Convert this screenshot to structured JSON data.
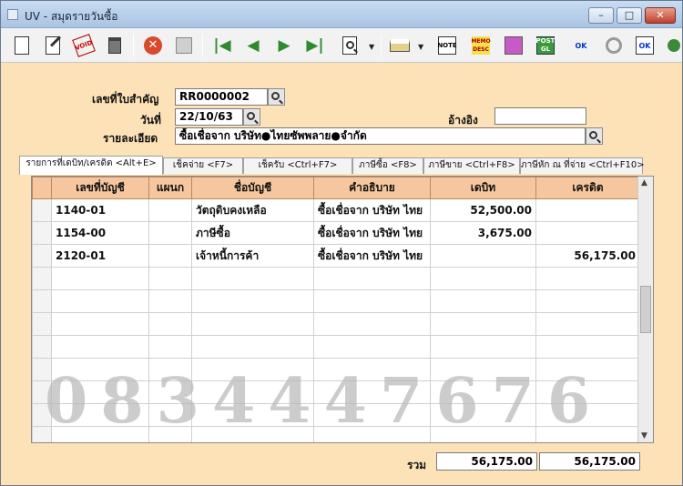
{
  "window": {
    "title": "UV - สมุดรายวันซื้อ"
  },
  "toolbar": {
    "icons": [
      "new-icon",
      "edit-icon",
      "void-icon",
      "delete-icon",
      "cancel-icon",
      "save-icon",
      "first-icon",
      "prev-icon",
      "next-icon",
      "last-icon",
      "search-icon",
      "print-icon",
      "note-icon",
      "memo-desc-icon",
      "grid-icon",
      "post-gl-icon",
      "approve-ok-icon",
      "tools-icon",
      "confirm-ok-icon"
    ],
    "labels": {
      "note": "NOTE",
      "desc": "MEMO DESC",
      "post": "POST GL",
      "ok": "OK"
    }
  },
  "form": {
    "doc_no_label": "เลขที่ใบสำคัญ",
    "doc_no": "RR0000002",
    "date_label": "วันที่",
    "date": "22/10/63",
    "ref_label": "อ้างอิง",
    "ref": "",
    "desc_label": "รายละเอียด",
    "desc": "ซื้อเชื่อจาก  บริษัท●ไทยซัพพลาย●จำกัด"
  },
  "tabs": [
    "รายการที่เดบิท/เครดิต <Alt+E>",
    "เช็คจ่าย <F7>",
    "เช็ครับ <Ctrl+F7>",
    "ภาษีซื้อ <F8>",
    "ภาษีขาย <Ctrl+F8>",
    "ภาษีหัก ณ ที่จ่าย <Ctrl+F10>"
  ],
  "grid": {
    "columns": [
      "เลขที่บัญชี",
      "แผนก",
      "ชื่อบัญชี",
      "คำอธิบาย",
      "เดบิท",
      "เครดิต"
    ],
    "rows": [
      [
        "1140-01",
        "",
        "วัตถุดิบคงเหลือ",
        "ซื้อเชื่อจาก  บริษัท  ไทย",
        "52,500.00",
        ""
      ],
      [
        "1154-00",
        "",
        "ภาษีซื้อ",
        "ซื้อเชื่อจาก  บริษัท  ไทย",
        "3,675.00",
        ""
      ],
      [
        "2120-01",
        "",
        "เจ้าหนี้การค้า",
        "ซื้อเชื่อจาก  บริษัท  ไทย",
        "",
        "56,175.00"
      ]
    ]
  },
  "totals": {
    "label": "รวม",
    "debit": "56,175.00",
    "credit": "56,175.00"
  },
  "watermark": "0834447676",
  "colors": {
    "form_bg": "#fde2b8",
    "header_bg": "#f6c79e"
  }
}
